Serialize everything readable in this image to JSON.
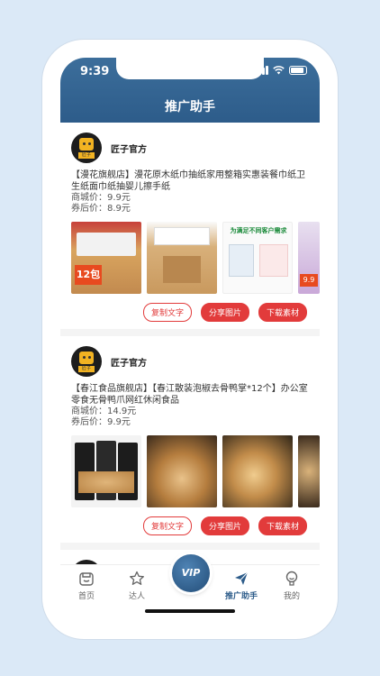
{
  "status": {
    "time": "9:39"
  },
  "header": {
    "title": "推广助手"
  },
  "posts": [
    {
      "shop": "匠子官方",
      "avatar_tag": "匠子",
      "description": "【漫花旗舰店】漫花原木纸巾抽纸家用整箱实惠装餐巾纸卫生纸面巾纸抽婴儿擦手纸",
      "mall_price": "商城价：9.9元",
      "coupon_price": "券后价：8.9元",
      "img_text_1": "12包",
      "img_text_2": "为满足不同客户需求",
      "img_text_3": "9.9"
    },
    {
      "shop": "匠子官方",
      "avatar_tag": "匠子",
      "description": "【春江食品旗舰店】【春江散装泡椒去骨鸭掌*12个】办公室零食无骨鸭爪网红休闲食品",
      "mall_price": "商城价：14.9元",
      "coupon_price": "券后价：9.9元"
    }
  ],
  "actions": {
    "copy": "复制文字",
    "share": "分享图片",
    "download": "下载素材"
  },
  "tabs": [
    {
      "label": "首页",
      "icon": "home-icon"
    },
    {
      "label": "达人",
      "icon": "star-icon"
    },
    {
      "label": "VIP",
      "icon": "vip-badge"
    },
    {
      "label": "推广助手",
      "icon": "send-icon",
      "active": true
    },
    {
      "label": "我的",
      "icon": "user-icon"
    }
  ],
  "colors": {
    "header": "#2d5c8a",
    "accent_red": "#e23b3b",
    "background": "#dbe9f7"
  }
}
